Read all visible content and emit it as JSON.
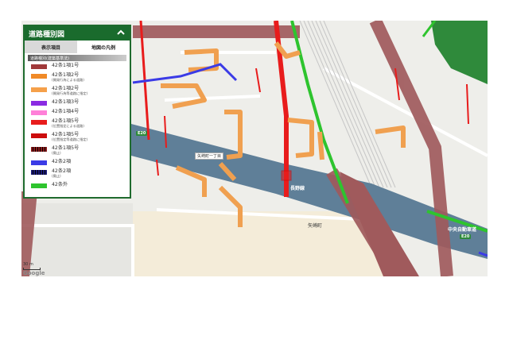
{
  "legend": {
    "title": "道路種別図",
    "tabs": [
      {
        "label": "表示項目",
        "active": false
      },
      {
        "label": "地図の凡例",
        "active": true
      }
    ],
    "subheader": "道路種別(建築基準法)",
    "items": [
      {
        "label": "42条1項1号",
        "note": "",
        "color": "#a0393a",
        "pattern": "solid"
      },
      {
        "label": "42条1項2号",
        "note": "(開発行為による道路)",
        "color": "#f08a28",
        "pattern": "solid"
      },
      {
        "label": "42条1項2号",
        "note": "(開発行為等道路に指定)",
        "color": "#f5a04a",
        "pattern": "solid"
      },
      {
        "label": "42条1項3号",
        "note": "",
        "color": "#8a2be2",
        "pattern": "solid"
      },
      {
        "label": "42条1項4号",
        "note": "",
        "color": "#ff7fd8",
        "pattern": "solid"
      },
      {
        "label": "42条1項5号",
        "note": "(位置指定による道路)",
        "color": "#e81c1c",
        "pattern": "solid"
      },
      {
        "label": "42条1項5号",
        "note": "(位置指定等道路に指定)",
        "color": "#cc0d0d",
        "pattern": "solid"
      },
      {
        "label": "42条1項5号",
        "note": "(廃止)",
        "color": "#8b1a1a",
        "pattern": "dotted"
      },
      {
        "label": "42条2項",
        "note": "",
        "color": "#3b3be6",
        "pattern": "solid"
      },
      {
        "label": "42条2項",
        "note": "(廃止)",
        "color": "#1b1b7a",
        "pattern": "dotted"
      },
      {
        "label": "42条外",
        "note": "",
        "color": "#2ec42e",
        "pattern": "solid"
      }
    ]
  },
  "map": {
    "place_labels": {
      "yazakicho": "矢崎町",
      "yazakicho_1": "矢崎町一丁目",
      "nagano_line": "長野線",
      "chuo_expressway": "中央自動車道",
      "e20_a": "E20",
      "e20_b": "E20"
    },
    "scale": "30 m",
    "attribution": "Google"
  },
  "colors": {
    "header_green": "#1a6b2d",
    "railway": "#5f7f98",
    "road_main": "#a05a5c",
    "green_road": "#2ec42e"
  }
}
